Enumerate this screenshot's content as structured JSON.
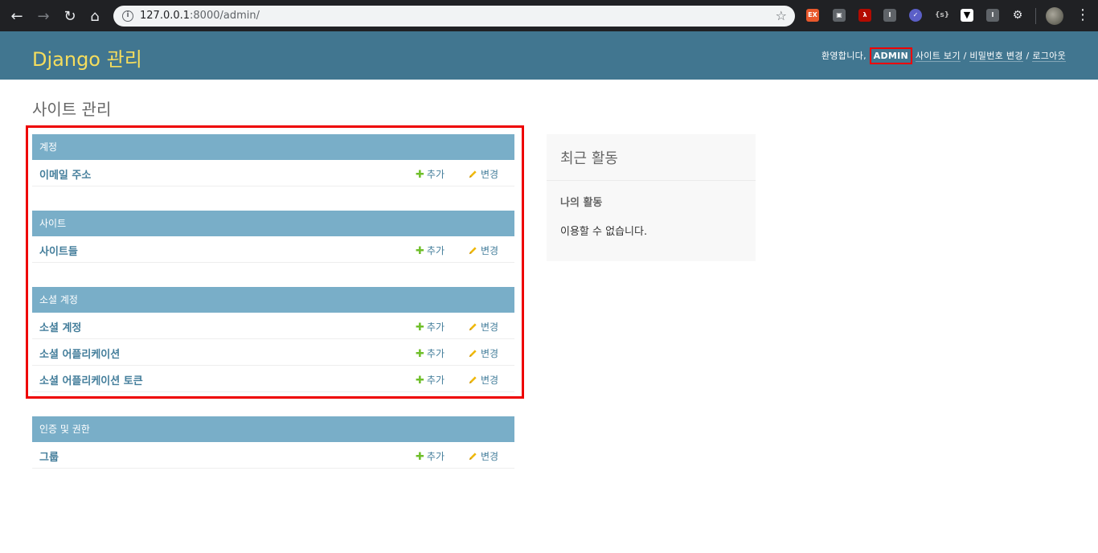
{
  "browser": {
    "url_host": "127.0.0.1",
    "url_rest": ":8000/admin/"
  },
  "header": {
    "branding": "Django 관리",
    "welcome": "환영합니다,",
    "username": "ADMIN",
    "view_site": "사이트 보기",
    "change_password": "비밀번호 변경",
    "logout": "로그아웃",
    "sep": "/"
  },
  "content": {
    "title": "사이트 관리"
  },
  "modules": [
    {
      "caption": "계정",
      "models": [
        {
          "name": "이메일 주소",
          "add": "추가",
          "change": "변경"
        }
      ]
    },
    {
      "caption": "사이트",
      "models": [
        {
          "name": "사이트들",
          "add": "추가",
          "change": "변경"
        }
      ]
    },
    {
      "caption": "소셜 계정",
      "models": [
        {
          "name": "소셜 계정",
          "add": "추가",
          "change": "변경"
        },
        {
          "name": "소셜 어플리케이션",
          "add": "추가",
          "change": "변경"
        },
        {
          "name": "소셜 어플리케이션 토큰",
          "add": "추가",
          "change": "변경"
        }
      ]
    },
    {
      "caption": "인증 및 권한",
      "models": [
        {
          "name": "그룹",
          "add": "추가",
          "change": "변경"
        }
      ]
    }
  ],
  "recent_actions": {
    "title": "최근 활동",
    "subtitle": "나의 활동",
    "empty": "이용할 수 없습니다."
  },
  "colors": {
    "header_bg": "#417690",
    "branding": "#f5dd5d",
    "caption_bg": "#79aec8",
    "link": "#447e9b",
    "add_icon": "#70bf2b",
    "change_icon": "#efb80b",
    "highlight": "#ee0000"
  }
}
